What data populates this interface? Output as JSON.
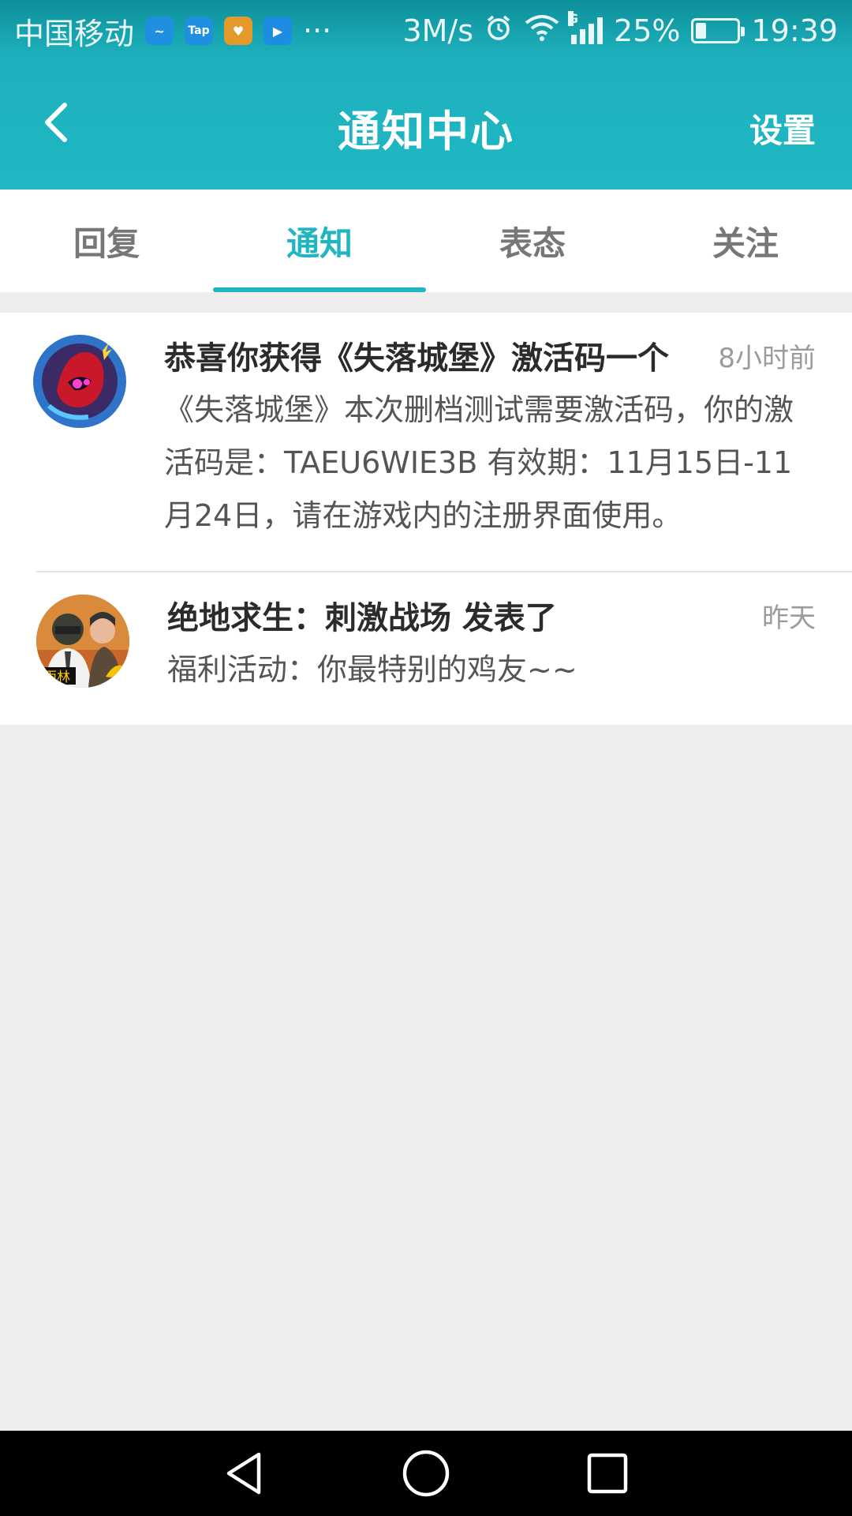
{
  "status_bar": {
    "carrier": "中国移动",
    "notif_icons": [
      "weibo-icon",
      "tap-icon",
      "health-icon",
      "video-icon"
    ],
    "more": "···",
    "speed": "3M/s",
    "battery": "25%",
    "battery_level": 0.25,
    "time": "19:39"
  },
  "header": {
    "title": "通知中心",
    "settings_label": "设置"
  },
  "tabs": [
    {
      "label": "回复",
      "active": false
    },
    {
      "label": "通知",
      "active": true
    },
    {
      "label": "表态",
      "active": false
    },
    {
      "label": "关注",
      "active": false
    }
  ],
  "notifications": [
    {
      "title": "恭喜你获得《失落城堡》激活码一个",
      "time": "8小时前",
      "desc": "《失落城堡》本次删档测试需要激活码，你的激活码是：TAEU6WIE3B 有效期：11月15日-11月24日，请在游戏内的注册界面使用。"
    },
    {
      "title": "绝地求生：刺激战场 发表了",
      "time": "昨天",
      "desc": "福利活动：你最特别的鸡友~~"
    }
  ],
  "colors": {
    "accent": "#21b5c1",
    "header": "#1fb8c3"
  }
}
